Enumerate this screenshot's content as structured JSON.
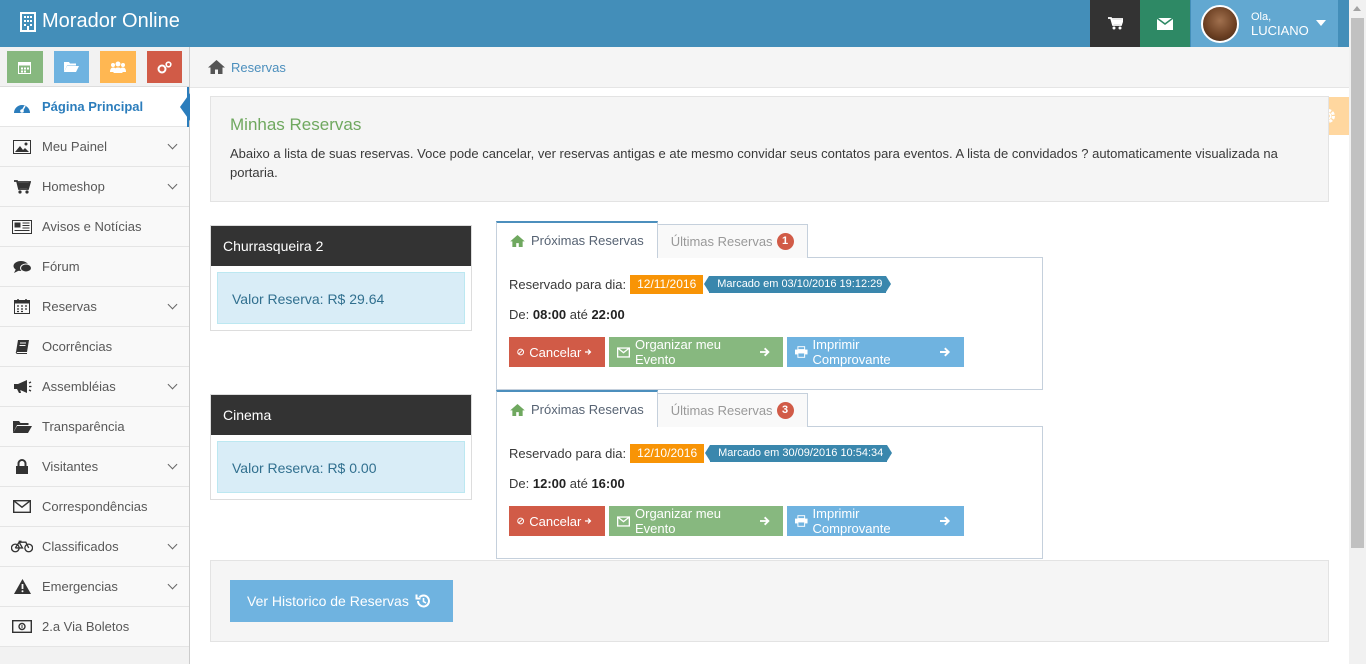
{
  "app": {
    "title": "Morador Online"
  },
  "user": {
    "greeting": "Ola,",
    "name": "LUCIANO"
  },
  "sidebar": {
    "items": [
      {
        "label": "Página Principal"
      },
      {
        "label": "Meu Painel"
      },
      {
        "label": "Homeshop"
      },
      {
        "label": "Avisos e Notícias"
      },
      {
        "label": "Fórum"
      },
      {
        "label": "Reservas"
      },
      {
        "label": "Ocorrências"
      },
      {
        "label": "Assembléias"
      },
      {
        "label": "Transparência"
      },
      {
        "label": "Visitantes"
      },
      {
        "label": "Correspondências"
      },
      {
        "label": "Classificados"
      },
      {
        "label": "Emergencias"
      },
      {
        "label": "2.a Via Boletos"
      }
    ]
  },
  "breadcrumb": {
    "current": "Reservas"
  },
  "intro": {
    "title": "Minhas Reservas",
    "text": "Abaixo a lista de suas reservas. Voce pode cancelar, ver reservas antigas e ate mesmo convidar seus contatos para eventos. A lista de convidados ? automaticamente visualizada na portaria."
  },
  "reservations": [
    {
      "venue": "Churrasqueira 2",
      "value_label": "Valor Reserva: R$ 29.64",
      "tab_next": "Próximas Reservas",
      "tab_last": "Últimas Reservas",
      "tab_last_badge": "1",
      "reserved_label": "Reservado para dia:",
      "date": "12/11/2016",
      "marked": "Marcado em 03/10/2016 19:12:29",
      "from_label": "De:",
      "from": "08:00",
      "until_label": "até",
      "until": "22:00",
      "cancel": "Cancelar",
      "organize": "Organizar meu Evento",
      "print": "Imprimir Comprovante"
    },
    {
      "venue": "Cinema",
      "value_label": "Valor Reserva: R$ 0.00",
      "tab_next": "Próximas Reservas",
      "tab_last": "Últimas Reservas",
      "tab_last_badge": "3",
      "reserved_label": "Reservado para dia:",
      "date": "12/10/2016",
      "marked": "Marcado em 30/09/2016 10:54:34",
      "from_label": "De:",
      "from": "12:00",
      "until_label": "até",
      "until": "16:00",
      "cancel": "Cancelar",
      "organize": "Organizar meu Evento",
      "print": "Imprimir Comprovante"
    }
  ],
  "history": {
    "button": "Ver Historico de Reservas"
  },
  "colors": {
    "navbar": "#438eb9",
    "success": "#87b87f",
    "info": "#6fb3e0",
    "warning": "#ffb752",
    "danger": "#d15b47"
  }
}
